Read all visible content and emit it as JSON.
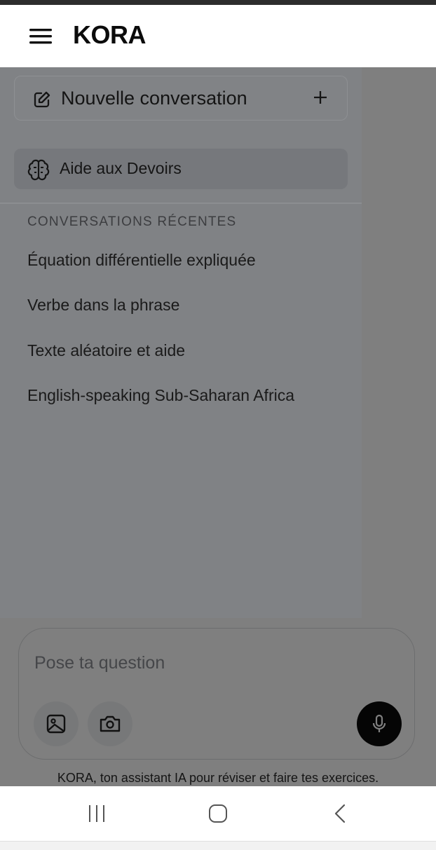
{
  "app": {
    "title": "KORA"
  },
  "drawer": {
    "new_conversation_label": "Nouvelle conversation",
    "homework_label": "Aide aux Devoirs",
    "recent_section_title": "CONVERSATIONS RÉCENTES",
    "recent_items": [
      {
        "label": "Équation différentielle expliquée"
      },
      {
        "label": "Verbe dans la phrase"
      },
      {
        "label": "Texte aléatoire et aide"
      },
      {
        "label": "English-speaking Sub-Saharan Africa"
      }
    ]
  },
  "composer": {
    "placeholder": "Pose ta question",
    "footer_note": "KORA, ton assistant IA pour réviser et faire tes exercices."
  },
  "icons": {
    "menu": "hamburger-menu-icon",
    "new": "edit-icon",
    "add": "plus-icon",
    "homework": "brain-icon",
    "image": "image-icon",
    "camera": "camera-icon",
    "mic": "microphone-icon"
  },
  "colors": {
    "overlay": "rgba(0,0,0,0.5)",
    "drawer_bg": "#808285",
    "mic_button": "#0b0b0b"
  }
}
